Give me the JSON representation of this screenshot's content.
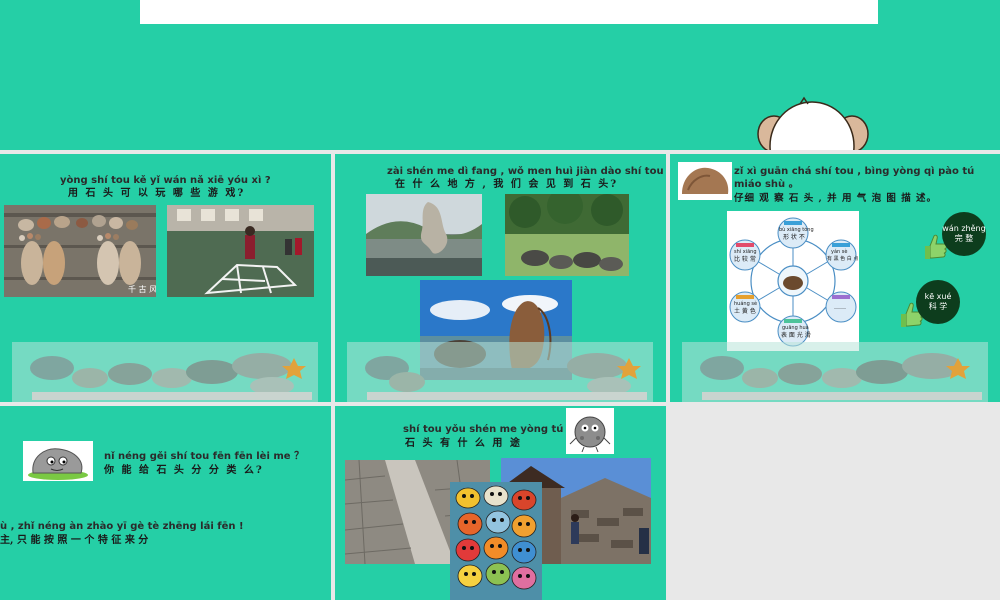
{
  "slide1": {
    "question_pinyin": "yòng shí tou  kě  yǐ  wán  nǎ  xiē yóu  xì ?",
    "question_han": "用  石 头  可 以 玩  哪 些  游 戏?",
    "photo_caption": "千 古 风"
  },
  "slide2": {
    "question_pinyin": "zài  shén  me  dì  fang ,   wǒ  men huì  jiàn dào  shí  tou ?",
    "question_han": "在  什  么  地  方 , 我 们  会  见  到  石  头?"
  },
  "slide3": {
    "instruction_pinyin_1": "zǐ  xì guān chá shí tou ,   bìng yòng qì    pào  tú",
    "instruction_pinyin_2": "miáo shù 。",
    "instruction_han": "仔细  观 察  石 头 , 并      用  气 泡 图  描 述。",
    "badge_complete_pinyin": "wán zhěng",
    "badge_complete_han": "完  整",
    "badge_science_pinyin": "kē xué",
    "badge_science_han": "科 学",
    "diagram_nodes": [
      {
        "pinyin": "bù  xiāng tóng",
        "han": "形 状 不"
      },
      {
        "pinyin": "shí  xiāng",
        "han": "比 较 常"
      },
      {
        "pinyin": "yán sè",
        "han": "有 黑 色 白 点"
      },
      {
        "pinyin": "",
        "han": "……"
      },
      {
        "pinyin": "huáng sè",
        "han": "土 黄 色"
      },
      {
        "pinyin": "guāng huá",
        "han": "表 面 光 滑"
      }
    ]
  },
  "slide4": {
    "question_pinyin": "nǐ néng gěi shí tou fēn fēn lèi me ？",
    "question_han": "你 能  给 石 头 分 分 类 么?",
    "hint_pinyin": "ù ,  zhǐ néng  àn  zhào  yī gè  tè  zhēng  lái  fēn !",
    "hint_han": "主, 只     能      按     照   一 个  特     征      来  分"
  },
  "slide5": {
    "question_pinyin": "shí tou yǒu shén me yòng tú ？",
    "question_han": "石 头  有    什 么    用 途"
  },
  "colors": {
    "slide_bg": "#25cfa6",
    "gap": "#e8e8e8",
    "badge": "#0d3d1d"
  }
}
